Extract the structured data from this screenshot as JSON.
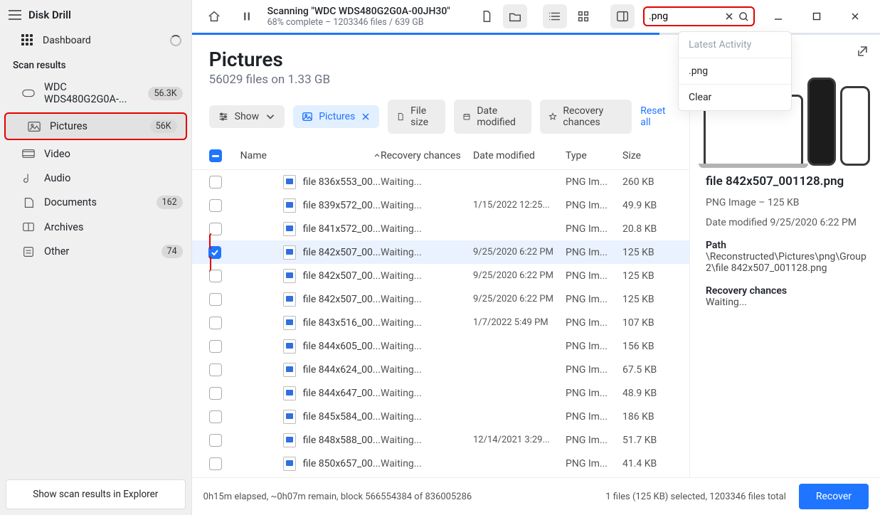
{
  "app": {
    "title": "Disk Drill"
  },
  "sidebar": {
    "dashboard": "Dashboard",
    "heading": "Scan results",
    "explorer_btn": "Show scan results in Explorer",
    "items": [
      {
        "label": "WDC WDS480G2G0A-...",
        "badge": "56.3K"
      },
      {
        "label": "Pictures",
        "badge": "56K"
      },
      {
        "label": "Video",
        "badge": ""
      },
      {
        "label": "Audio",
        "badge": ""
      },
      {
        "label": "Documents",
        "badge": "162"
      },
      {
        "label": "Archives",
        "badge": ""
      },
      {
        "label": "Other",
        "badge": "74"
      }
    ]
  },
  "titlebar": {
    "scan_line1": "Scanning \"WDC WDS480G2G0A-00JH30\"",
    "scan_line2": "68% complete – 1203346 files / 639 GB"
  },
  "search": {
    "value": ".png",
    "dd_heading": "Latest Activity",
    "dd_items": [
      ".png",
      "Clear"
    ]
  },
  "page": {
    "title": "Pictures",
    "subtitle": "56029 files on 1.33 GB"
  },
  "filters": {
    "show": "Show",
    "pictures": "Pictures",
    "file_size": "File size",
    "date_modified": "Date modified",
    "recovery": "Recovery chances",
    "reset": "Reset all"
  },
  "columns": {
    "name": "Name",
    "recovery": "Recovery chances",
    "date": "Date modified",
    "type": "Type",
    "size": "Size"
  },
  "rows": [
    {
      "name": "file 836x553_00...",
      "rc": "Waiting...",
      "date": "",
      "type": "PNG Im...",
      "size": "260 KB",
      "sel": false
    },
    {
      "name": "file 839x572_00...",
      "rc": "Waiting...",
      "date": "1/15/2022 12:25...",
      "type": "PNG Im...",
      "size": "49.9 KB",
      "sel": false
    },
    {
      "name": "file 841x572_00...",
      "rc": "Waiting...",
      "date": "",
      "type": "PNG Im...",
      "size": "20.8 KB",
      "sel": false
    },
    {
      "name": "file 842x507_00...",
      "rc": "Waiting...",
      "date": "9/25/2020 6:22 PM",
      "type": "PNG Im...",
      "size": "125 KB",
      "sel": true
    },
    {
      "name": "file 842x507_00...",
      "rc": "Waiting...",
      "date": "9/25/2020 6:22 PM",
      "type": "PNG Im...",
      "size": "125 KB",
      "sel": false
    },
    {
      "name": "file 842x507_00...",
      "rc": "Waiting...",
      "date": "9/25/2020 6:22 PM",
      "type": "PNG Im...",
      "size": "125 KB",
      "sel": false
    },
    {
      "name": "file 843x516_00...",
      "rc": "Waiting...",
      "date": "1/7/2022 5:49 PM",
      "type": "PNG Im...",
      "size": "107 KB",
      "sel": false
    },
    {
      "name": "file 844x605_00...",
      "rc": "Waiting...",
      "date": "",
      "type": "PNG Im...",
      "size": "156 KB",
      "sel": false
    },
    {
      "name": "file 844x624_00...",
      "rc": "Waiting...",
      "date": "",
      "type": "PNG Im...",
      "size": "67.5 KB",
      "sel": false
    },
    {
      "name": "file 844x647_00...",
      "rc": "Waiting...",
      "date": "",
      "type": "PNG Im...",
      "size": "48.9 KB",
      "sel": false
    },
    {
      "name": "file 845x584_00...",
      "rc": "Waiting...",
      "date": "",
      "type": "PNG Im...",
      "size": "186 KB",
      "sel": false
    },
    {
      "name": "file 848x588_00...",
      "rc": "Waiting...",
      "date": "12/14/2021 3:29...",
      "type": "PNG Im...",
      "size": "51.7 KB",
      "sel": false
    },
    {
      "name": "file 850x657_00...",
      "rc": "Waiting...",
      "date": "",
      "type": "PNG Im...",
      "size": "41.4 KB",
      "sel": false
    }
  ],
  "details": {
    "title": "file 842x507_001128.png",
    "meta": "PNG Image – 125 KB",
    "date_label": "Date modified 9/25/2020 6:22 PM",
    "path_h": "Path",
    "path_v": "\\Reconstructed\\Pictures\\png\\Group 2\\file 842x507_001128.png",
    "rc_h": "Recovery chances",
    "rc_v": "Waiting..."
  },
  "status": {
    "left": "0h15m elapsed, ~0h07m remain, block 566554384 of 836005286",
    "right": "1 files (125 KB) selected, 1203346 files total",
    "recover": "Recover"
  }
}
